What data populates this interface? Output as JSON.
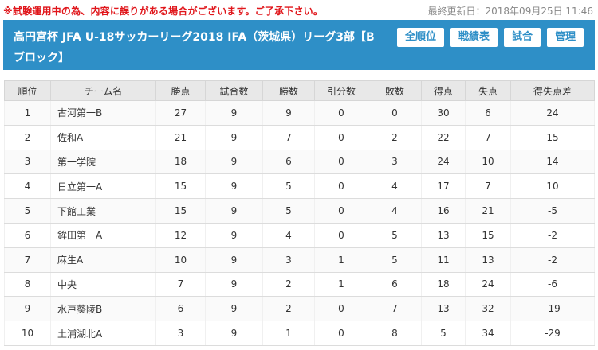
{
  "notice": "※試験運用中の為、内容に誤りがある場合がございます。ご了承下さい。",
  "updated": "最終更新日：2018年09月25日 11:46",
  "title": "高円宮杯 JFA U-18サッカーリーグ2018 IFA（茨城県）リーグ3部【Bブロック】",
  "buttons": {
    "all_ranking": "全順位",
    "results": "戦績表",
    "matches": "試合",
    "admin": "管理"
  },
  "columns": [
    "順位",
    "チーム名",
    "勝点",
    "試合数",
    "勝数",
    "引分数",
    "敗数",
    "得点",
    "失点",
    "得失点差"
  ],
  "rows": [
    {
      "rank": "1",
      "team": "古河第一B",
      "points": "27",
      "played": "9",
      "won": "9",
      "drawn": "0",
      "lost": "0",
      "gf": "30",
      "ga": "6",
      "gd": "24"
    },
    {
      "rank": "2",
      "team": "佐和A",
      "points": "21",
      "played": "9",
      "won": "7",
      "drawn": "0",
      "lost": "2",
      "gf": "22",
      "ga": "7",
      "gd": "15"
    },
    {
      "rank": "3",
      "team": "第一学院",
      "points": "18",
      "played": "9",
      "won": "6",
      "drawn": "0",
      "lost": "3",
      "gf": "24",
      "ga": "10",
      "gd": "14"
    },
    {
      "rank": "4",
      "team": "日立第一A",
      "points": "15",
      "played": "9",
      "won": "5",
      "drawn": "0",
      "lost": "4",
      "gf": "17",
      "ga": "7",
      "gd": "10"
    },
    {
      "rank": "5",
      "team": "下館工業",
      "points": "15",
      "played": "9",
      "won": "5",
      "drawn": "0",
      "lost": "4",
      "gf": "16",
      "ga": "21",
      "gd": "-5"
    },
    {
      "rank": "6",
      "team": "鉾田第一A",
      "points": "12",
      "played": "9",
      "won": "4",
      "drawn": "0",
      "lost": "5",
      "gf": "13",
      "ga": "15",
      "gd": "-2"
    },
    {
      "rank": "7",
      "team": "麻生A",
      "points": "10",
      "played": "9",
      "won": "3",
      "drawn": "1",
      "lost": "5",
      "gf": "11",
      "ga": "13",
      "gd": "-2"
    },
    {
      "rank": "8",
      "team": "中央",
      "points": "7",
      "played": "9",
      "won": "2",
      "drawn": "1",
      "lost": "6",
      "gf": "18",
      "ga": "24",
      "gd": "-6"
    },
    {
      "rank": "9",
      "team": "水戸葵陵B",
      "points": "6",
      "played": "9",
      "won": "2",
      "drawn": "0",
      "lost": "7",
      "gf": "13",
      "ga": "32",
      "gd": "-19"
    },
    {
      "rank": "10",
      "team": "土浦湖北A",
      "points": "3",
      "played": "9",
      "won": "1",
      "drawn": "0",
      "lost": "8",
      "gf": "5",
      "ga": "34",
      "gd": "-29"
    }
  ],
  "colors": {
    "header_bg": "#2e8fc7",
    "notice_red": "#e0161b"
  }
}
